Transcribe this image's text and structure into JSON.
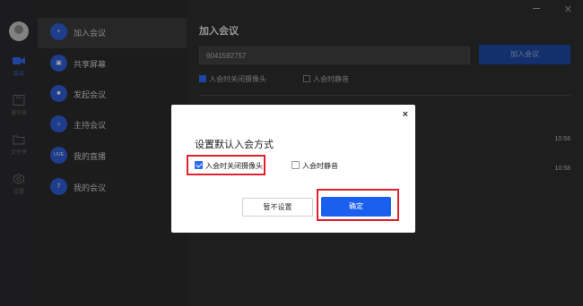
{
  "rail": {
    "items": [
      {
        "label": "会议",
        "icon": "video-camera-icon"
      },
      {
        "label": "通讯录",
        "icon": "contacts-icon"
      },
      {
        "label": "文件夹",
        "icon": "folder-icon"
      },
      {
        "label": "设置",
        "icon": "gear-icon"
      }
    ]
  },
  "menu": {
    "items": [
      {
        "label": "加入会议",
        "icon": "plus-icon",
        "glyph": "+"
      },
      {
        "label": "共享屏幕",
        "icon": "share-screen-icon",
        "glyph": "▣"
      },
      {
        "label": "发起会议",
        "icon": "video-icon",
        "glyph": "■"
      },
      {
        "label": "主持会议",
        "icon": "host-icon",
        "glyph": "⌂"
      },
      {
        "label": "我的直播",
        "icon": "live-icon",
        "glyph": "LIVE"
      },
      {
        "label": "我的会议",
        "icon": "calendar-icon",
        "glyph": "7"
      }
    ]
  },
  "main": {
    "title": "加入会议",
    "meeting_id": "9041592757",
    "join_label": "加入会议",
    "opt_camera": "入会时关闭摄像头",
    "opt_mute": "入会时静音",
    "times": [
      "10:58",
      "10:58"
    ]
  },
  "dialog": {
    "close": "×",
    "title": "设置默认入会方式",
    "opt_camera": "入会时关闭摄像头",
    "opt_mute": "入会时静音",
    "cancel_label": "暂不设置",
    "ok_label": "确定"
  },
  "colors": {
    "accent": "#2f6cf6",
    "highlight_red": "#e0202a"
  }
}
